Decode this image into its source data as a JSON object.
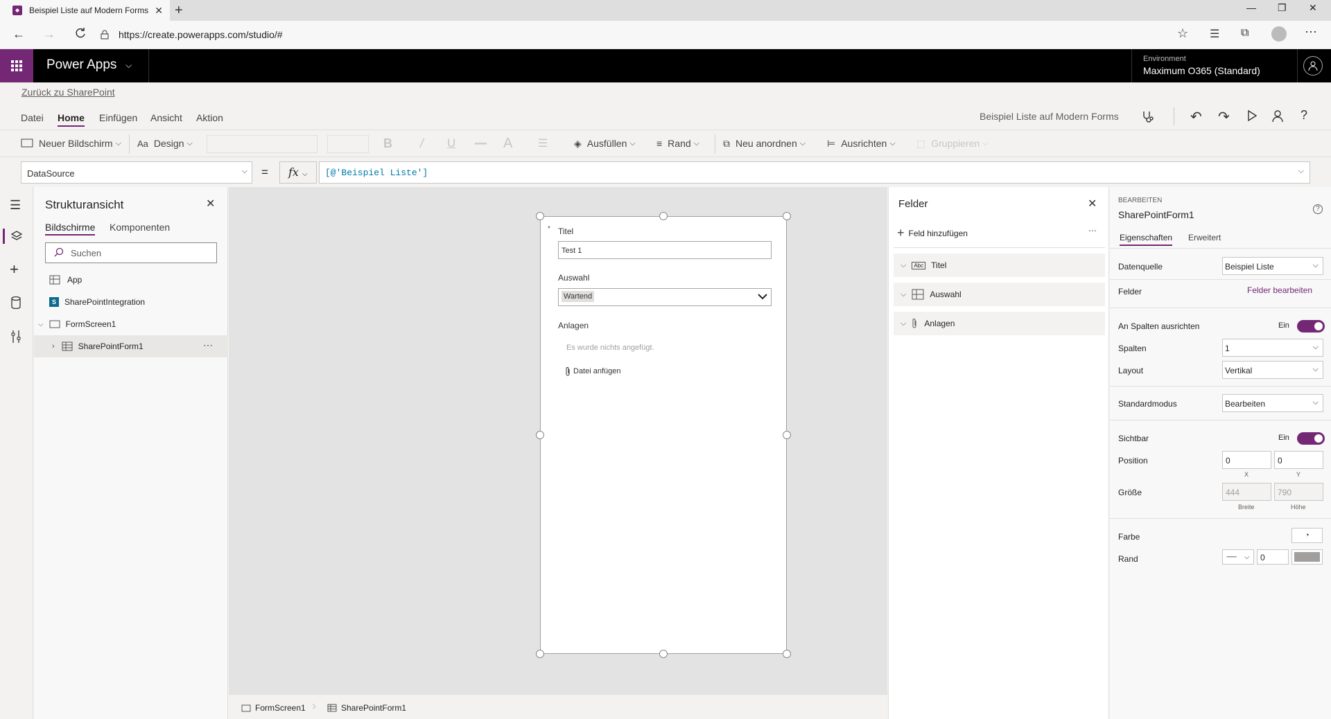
{
  "browser": {
    "tab_title": "Beispiel Liste auf Modern Forms",
    "url": "https://create.powerapps.com/studio/#"
  },
  "app": {
    "name": "Power Apps",
    "env_label": "Environment",
    "env_value": "Maximum O365 (Standard)"
  },
  "cmd": {
    "back_link": "Zurück zu SharePoint",
    "menu": [
      "Datei",
      "Home",
      "Einfügen",
      "Ansicht",
      "Aktion"
    ],
    "app_title": "Beispiel Liste auf Modern Forms"
  },
  "ribbon": {
    "new_screen": "Neuer Bildschirm",
    "design": "Design",
    "fill": "Ausfüllen",
    "border": "Rand",
    "reorder": "Neu anordnen",
    "align": "Ausrichten",
    "group": "Gruppieren"
  },
  "formula": {
    "property": "DataSource",
    "eq": "=",
    "fx": "fx",
    "value": "[@'Beispiel Liste']"
  },
  "tree": {
    "title": "Strukturansicht",
    "tab_screens": "Bildschirme",
    "tab_components": "Komponenten",
    "search_placeholder": "Suchen",
    "nodes": [
      "App",
      "SharePointIntegration",
      "FormScreen1",
      "SharePointForm1"
    ]
  },
  "form": {
    "title_label": "Titel",
    "required_mark": "*",
    "title_value": "Test 1",
    "choice_label": "Auswahl",
    "choice_value": "Wartend",
    "attach_label": "Anlagen",
    "attach_empty": "Es wurde nichts angefügt.",
    "attach_button": "Datei anfügen"
  },
  "footer": {
    "crumb1": "FormScreen1",
    "crumb2": "SharePointForm1"
  },
  "fields_pane": {
    "title": "Felder",
    "add": "Feld hinzufügen",
    "items": [
      "Titel",
      "Auswahl",
      "Anlagen"
    ]
  },
  "props": {
    "section": "BEARBEITEN",
    "control": "SharePointForm1",
    "tab_props": "Eigenschaften",
    "tab_adv": "Erweitert",
    "datasource_label": "Datenquelle",
    "datasource_value": "Beispiel Liste",
    "fields_label": "Felder",
    "fields_link": "Felder bearbeiten",
    "snap_label": "An Spalten ausrichten",
    "snap_value": "Ein",
    "columns_label": "Spalten",
    "columns_value": "1",
    "layout_label": "Layout",
    "layout_value": "Vertikal",
    "mode_label": "Standardmodus",
    "mode_value": "Bearbeiten",
    "visible_label": "Sichtbar",
    "visible_value": "Ein",
    "position_label": "Position",
    "pos_x": "0",
    "pos_y": "0",
    "x_label": "X",
    "y_label": "Y",
    "size_label": "Größe",
    "width": "444",
    "height": "790",
    "width_label": "Breite",
    "height_label": "Höhe",
    "color_label": "Farbe",
    "border_label": "Rand",
    "border_width": "0"
  },
  "colors": {
    "accent": "#742774",
    "header_bg": "#000000",
    "link": "#742774"
  }
}
